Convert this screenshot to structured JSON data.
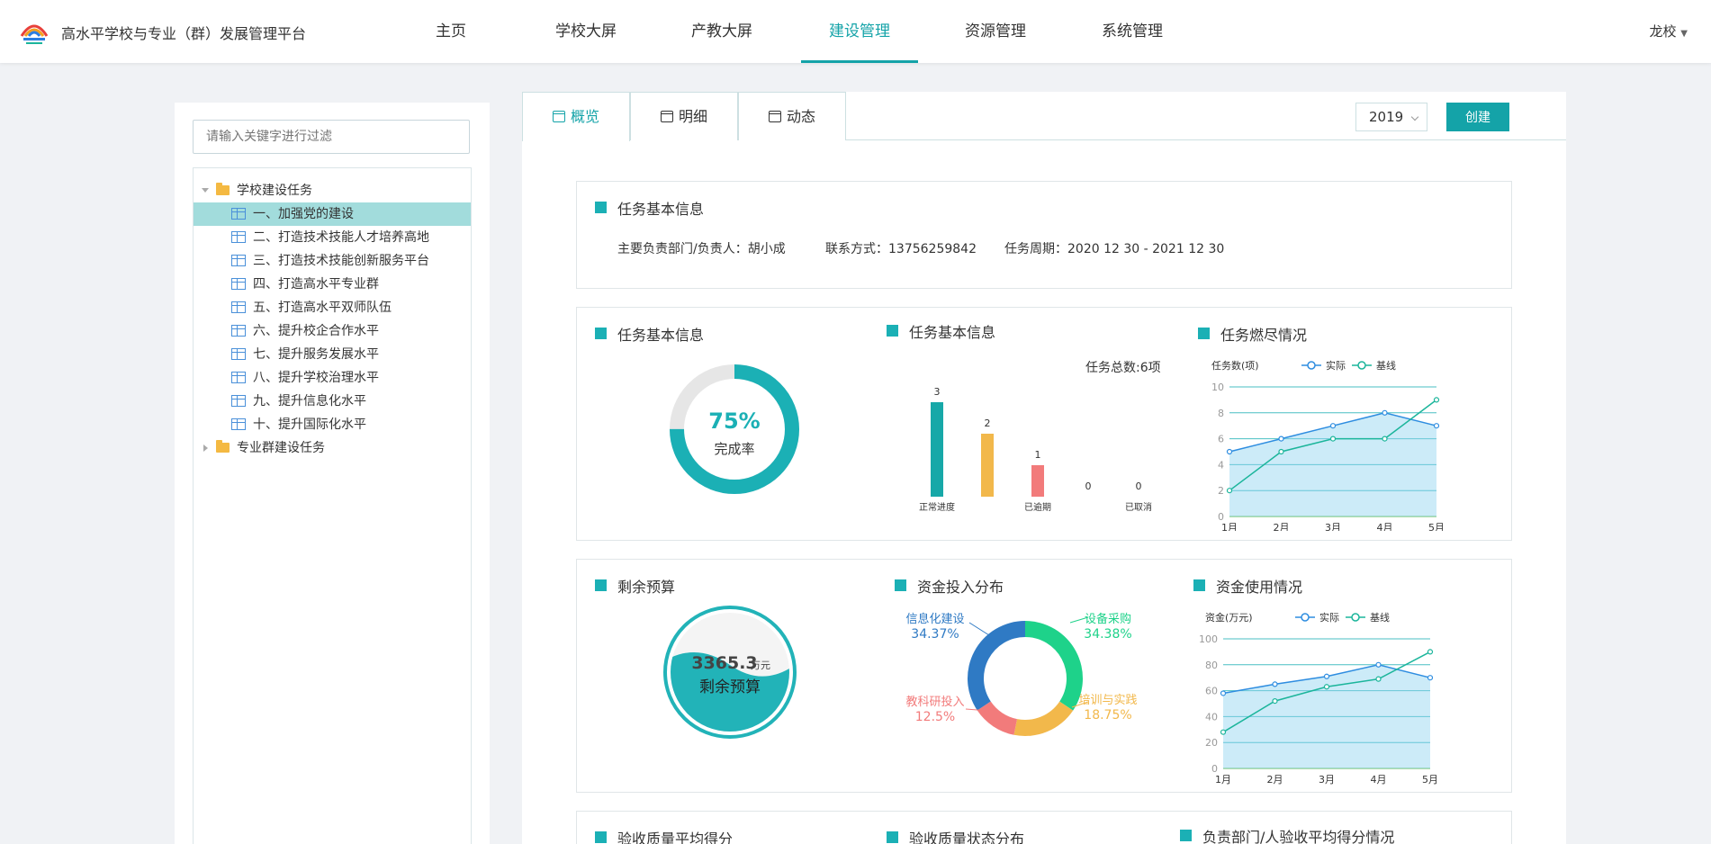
{
  "app": {
    "title": "高水平学校与专业（群）发展管理平台",
    "user": "龙校"
  },
  "nav": [
    {
      "label": "主页"
    },
    {
      "label": "学校大屏"
    },
    {
      "label": "产教大屏"
    },
    {
      "label": "建设管理",
      "active": true
    },
    {
      "label": "资源管理"
    },
    {
      "label": "系统管理"
    }
  ],
  "sidebar": {
    "filter_placeholder": "请输入关键字进行过滤",
    "tree": [
      {
        "label": "学校建设任务",
        "type": "folder",
        "expanded": true
      },
      {
        "label": "一、加强党的建设",
        "type": "item",
        "selected": true
      },
      {
        "label": "二、打造技术技能人才培养高地",
        "type": "item"
      },
      {
        "label": "三、打造技术技能创新服务平台",
        "type": "item"
      },
      {
        "label": "四、打造高水平专业群",
        "type": "item"
      },
      {
        "label": "五、打造高水平双师队伍",
        "type": "item"
      },
      {
        "label": "六、提升校企合作水平",
        "type": "item"
      },
      {
        "label": "七、提升服务发展水平",
        "type": "item"
      },
      {
        "label": "八、提升学校治理水平",
        "type": "item"
      },
      {
        "label": "九、提升信息化水平",
        "type": "item"
      },
      {
        "label": "十、提升国际化水平",
        "type": "item"
      },
      {
        "label": "专业群建设任务",
        "type": "folder",
        "expanded": false
      }
    ]
  },
  "tabs": [
    {
      "label": "概览",
      "active": true
    },
    {
      "label": "明细"
    },
    {
      "label": "动态"
    }
  ],
  "year": "2019",
  "create_label": "创建",
  "task_info": {
    "title": "任务基本信息",
    "dept_label": "主要负责部门/负责人：",
    "dept_value": "胡小成",
    "contact_label": "联系方式：",
    "contact_value": "13756259842",
    "period_label": "任务周期：",
    "period_value": "2020 12 30 - 2021 12 30"
  },
  "colors": {
    "accent": "#14a3a8",
    "real": "#2e8de0",
    "base": "#1bb59b",
    "normal": "#17a8a8",
    "late": "#f2b84b",
    "overdue": "#f27b7b"
  },
  "completion": {
    "title": "任务基本信息",
    "value": "75%",
    "label": "完成率",
    "fraction": 0.75
  },
  "status_chart": {
    "title": "任务基本信息",
    "total_label": "任务总数:6项"
  },
  "burndown": {
    "title": "任务燃尽情况"
  },
  "budget": {
    "title": "剩余预算",
    "amount": "3365.3",
    "unit": "万元",
    "label": "剩余预算"
  },
  "investment": {
    "title": "资金投入分布"
  },
  "fund_usage": {
    "title": "资金使用情况"
  },
  "bottom_titles": [
    "验收质量平均得分",
    "验收质量状态分布",
    "负责部门/人验收平均得分情况"
  ],
  "chart_data": [
    {
      "type": "bar",
      "categories": [
        "正常进度",
        "",
        "已逾期",
        "",
        "已取消"
      ],
      "values": [
        3,
        2,
        1,
        0,
        0
      ]
    },
    {
      "type": "line",
      "ylabel": "任务数(项)",
      "categories": [
        "1月",
        "2月",
        "3月",
        "4月",
        "5月"
      ],
      "ylim": [
        0,
        10
      ],
      "yticks": [
        0,
        2,
        4,
        6,
        8,
        10
      ],
      "series": [
        {
          "name": "实际",
          "values": [
            5,
            6,
            7,
            8,
            7
          ]
        },
        {
          "name": "基线",
          "values": [
            2,
            5,
            6,
            6,
            9
          ]
        }
      ]
    },
    {
      "type": "pie",
      "slices": [
        {
          "label": "设备采购",
          "pct": "34.38%",
          "value": 34.38
        },
        {
          "label": "培训与实践",
          "pct": "18.75%",
          "value": 18.75
        },
        {
          "label": "教科研投入",
          "pct": "12.5%",
          "value": 12.5
        },
        {
          "label": "信息化建设",
          "pct": "34.37%",
          "value": 34.37
        }
      ]
    },
    {
      "type": "line",
      "ylabel": "资金(万元)",
      "categories": [
        "1月",
        "2月",
        "3月",
        "4月",
        "5月"
      ],
      "ylim": [
        0,
        100
      ],
      "yticks": [
        0,
        20,
        40,
        60,
        80,
        100
      ],
      "series": [
        {
          "name": "实际",
          "values": [
            58,
            65,
            71,
            80,
            70
          ]
        },
        {
          "name": "基线",
          "values": [
            28,
            52,
            63,
            69,
            90
          ]
        }
      ]
    }
  ]
}
